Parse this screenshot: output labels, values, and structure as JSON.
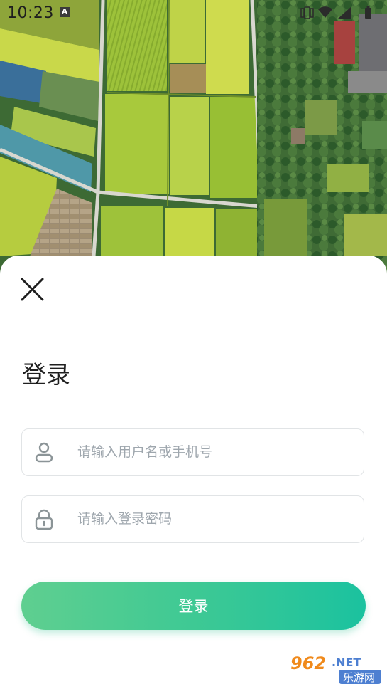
{
  "status_bar": {
    "time": "10:23",
    "keyboard_indicator": "A",
    "icons": [
      "vibrate-icon",
      "wifi-icon",
      "signal-icon",
      "battery-icon"
    ]
  },
  "hero": {
    "image": "aerial-farmland-photo"
  },
  "login_sheet": {
    "close_icon": "close-icon",
    "title": "登录",
    "username": {
      "icon": "user-icon",
      "placeholder": "请输入用户名或手机号",
      "value": ""
    },
    "password": {
      "icon": "lock-icon",
      "placeholder": "请输入登录密码",
      "value": ""
    },
    "submit_label": "登录"
  },
  "watermark": {
    "top": "962.NET",
    "bottom": "乐游网"
  },
  "colors": {
    "button_start": "#5fcf90",
    "button_end": "#1bc29f",
    "placeholder": "#9ea6ad",
    "field_border": "#e1e4e6",
    "icon_gray": "#8b9497"
  }
}
